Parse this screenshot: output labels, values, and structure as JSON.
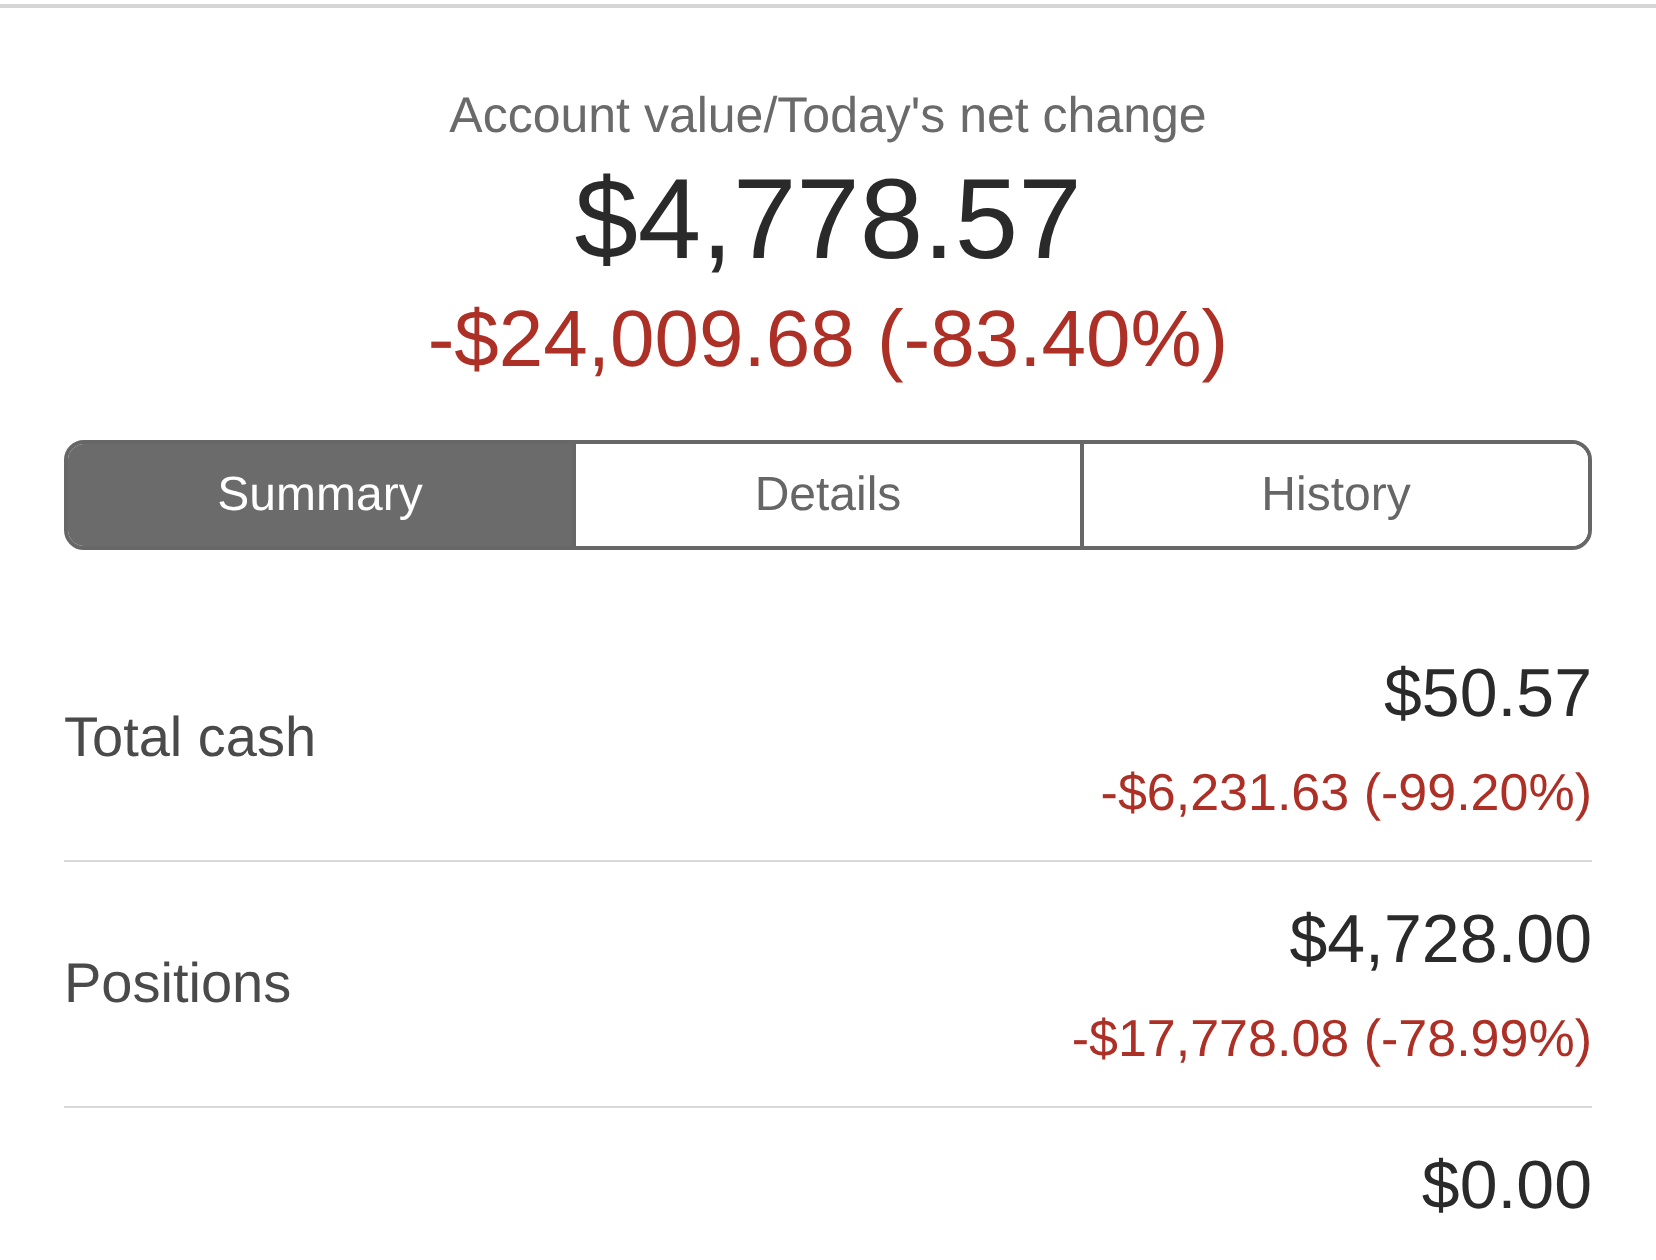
{
  "header": {
    "title": "Account value/Today's net change",
    "value": "$4,778.57",
    "change": "-$24,009.68 (-83.40%)"
  },
  "tabs": [
    {
      "label": "Summary",
      "selected": true
    },
    {
      "label": "Details",
      "selected": false
    },
    {
      "label": "History",
      "selected": false
    }
  ],
  "rows": [
    {
      "label": "Total cash",
      "value": "$50.57",
      "change": "-$6,231.63 (-99.20%)"
    },
    {
      "label": "Positions",
      "value": "$4,728.00",
      "change": "-$17,778.08 (-78.99%)"
    },
    {
      "value": "$0.00"
    }
  ]
}
